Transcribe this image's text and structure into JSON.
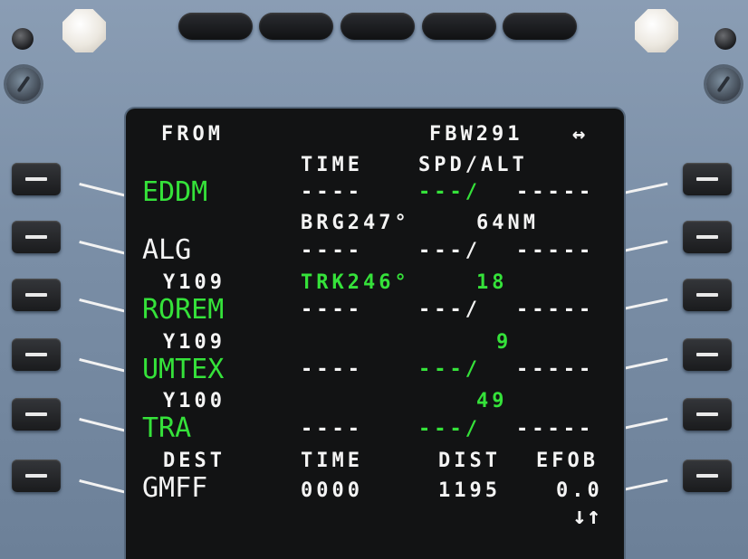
{
  "header": {
    "from_label": "FROM",
    "flight_number": "FBW291",
    "arrows_glyph": "↔"
  },
  "columns": {
    "time": "TIME",
    "spd_alt": "SPD/ALT"
  },
  "rows": [
    {
      "waypoint": "EDDM",
      "waypoint_color": "green",
      "time": "----",
      "speed": "---/",
      "alt": "-----",
      "speed_color": "green"
    },
    {
      "leg": "BRG247°",
      "leg_dist": "64NM",
      "leg_color": "white",
      "waypoint": "ALG",
      "waypoint_color": "white",
      "time": "----",
      "speed": "---/",
      "alt": "-----",
      "speed_color": "white"
    },
    {
      "airway": "Y109",
      "leg": "TRK246°",
      "leg_dist": "18",
      "leg_color": "green",
      "waypoint": "ROREM",
      "waypoint_color": "green",
      "time": "----",
      "speed": "---/",
      "alt": "-----",
      "speed_color": "white"
    },
    {
      "airway": "Y109",
      "leg_dist": "9",
      "leg_color": "green",
      "waypoint": "UMTEX",
      "waypoint_color": "green",
      "time": "----",
      "speed": "---/",
      "alt": "-----",
      "speed_color": "green"
    },
    {
      "airway": "Y100",
      "leg_dist": "49",
      "leg_color": "green",
      "waypoint": "TRA",
      "waypoint_color": "green",
      "time": "----",
      "speed": "---/",
      "alt": "-----",
      "speed_color": "green"
    }
  ],
  "footer": {
    "dest_label": "DEST",
    "time_label": "TIME",
    "dist_label": "DIST",
    "efob_label": "EFOB",
    "dest": "GMFF",
    "time": "0000",
    "dist": "1195",
    "efob": "0.0",
    "scroll_glyph": "↓↑"
  },
  "colors": {
    "green": "#35e23a",
    "white": "#f4f4f4",
    "screen": "#121314",
    "bezel": "#7a8ea6"
  }
}
